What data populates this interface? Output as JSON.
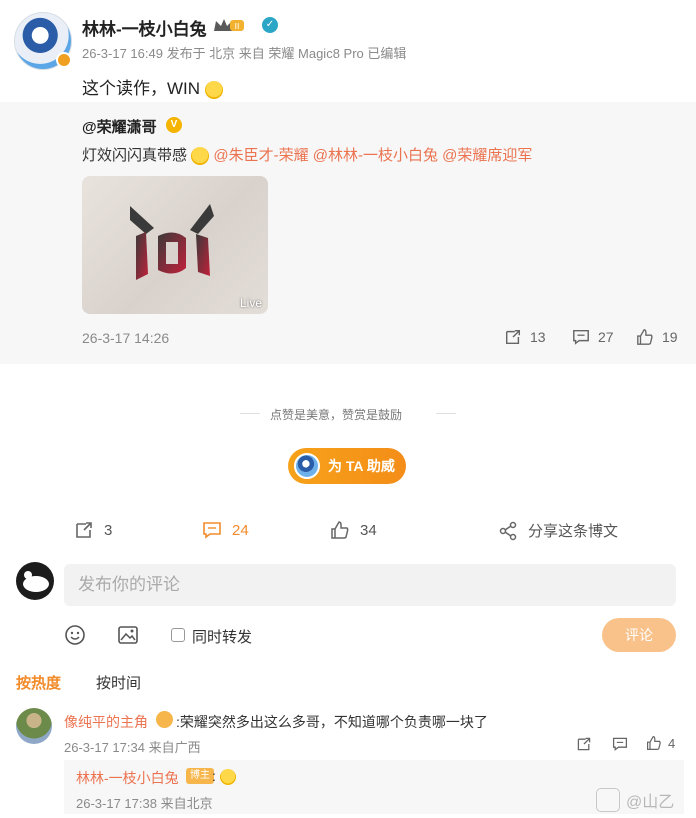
{
  "post": {
    "author": "林林-一枝小白兔",
    "meta": "26-3-17 16:49  发布于 北京  来自 荣耀 Magic8 Pro 已编辑",
    "text": "这个读作，WIN"
  },
  "repost": {
    "author": "@荣耀潇哥",
    "text": "灯效闪闪真带感",
    "mentions": [
      "@朱臣才-荣耀",
      "@林林-一枝小白兔",
      "@荣耀席迎军"
    ],
    "media_label": "Live",
    "time": "26-3-17 14:26",
    "stats": {
      "reposts": "13",
      "comments": "27",
      "likes": "19"
    }
  },
  "support": {
    "tip": "点赞是美意，赞赏是鼓励",
    "button_label": "为 TA 助威"
  },
  "actions": {
    "reposts": "3",
    "comments": "24",
    "likes": "34",
    "share_label": "分享这条博文"
  },
  "comment_box": {
    "placeholder": "发布你的评论",
    "repost_checkbox_label": "同时转发",
    "submit_label": "评论"
  },
  "sort": {
    "hot": "按热度",
    "time": "按时间"
  },
  "comments": [
    {
      "name": "像纯平的主角",
      "text": ":荣耀突然多出这么多哥，不知道哪个负责哪一块了",
      "meta": "26-3-17 17:34 来自广西",
      "likes": "4",
      "reply": {
        "name": "林林-一枝小白兔",
        "badge": "博主",
        "text": ":",
        "meta": "26-3-17 17:38 来自北京"
      }
    }
  ],
  "watermark": "@山乙",
  "colors": {
    "accent": "#f28b2a",
    "mention": "#eb7350"
  }
}
